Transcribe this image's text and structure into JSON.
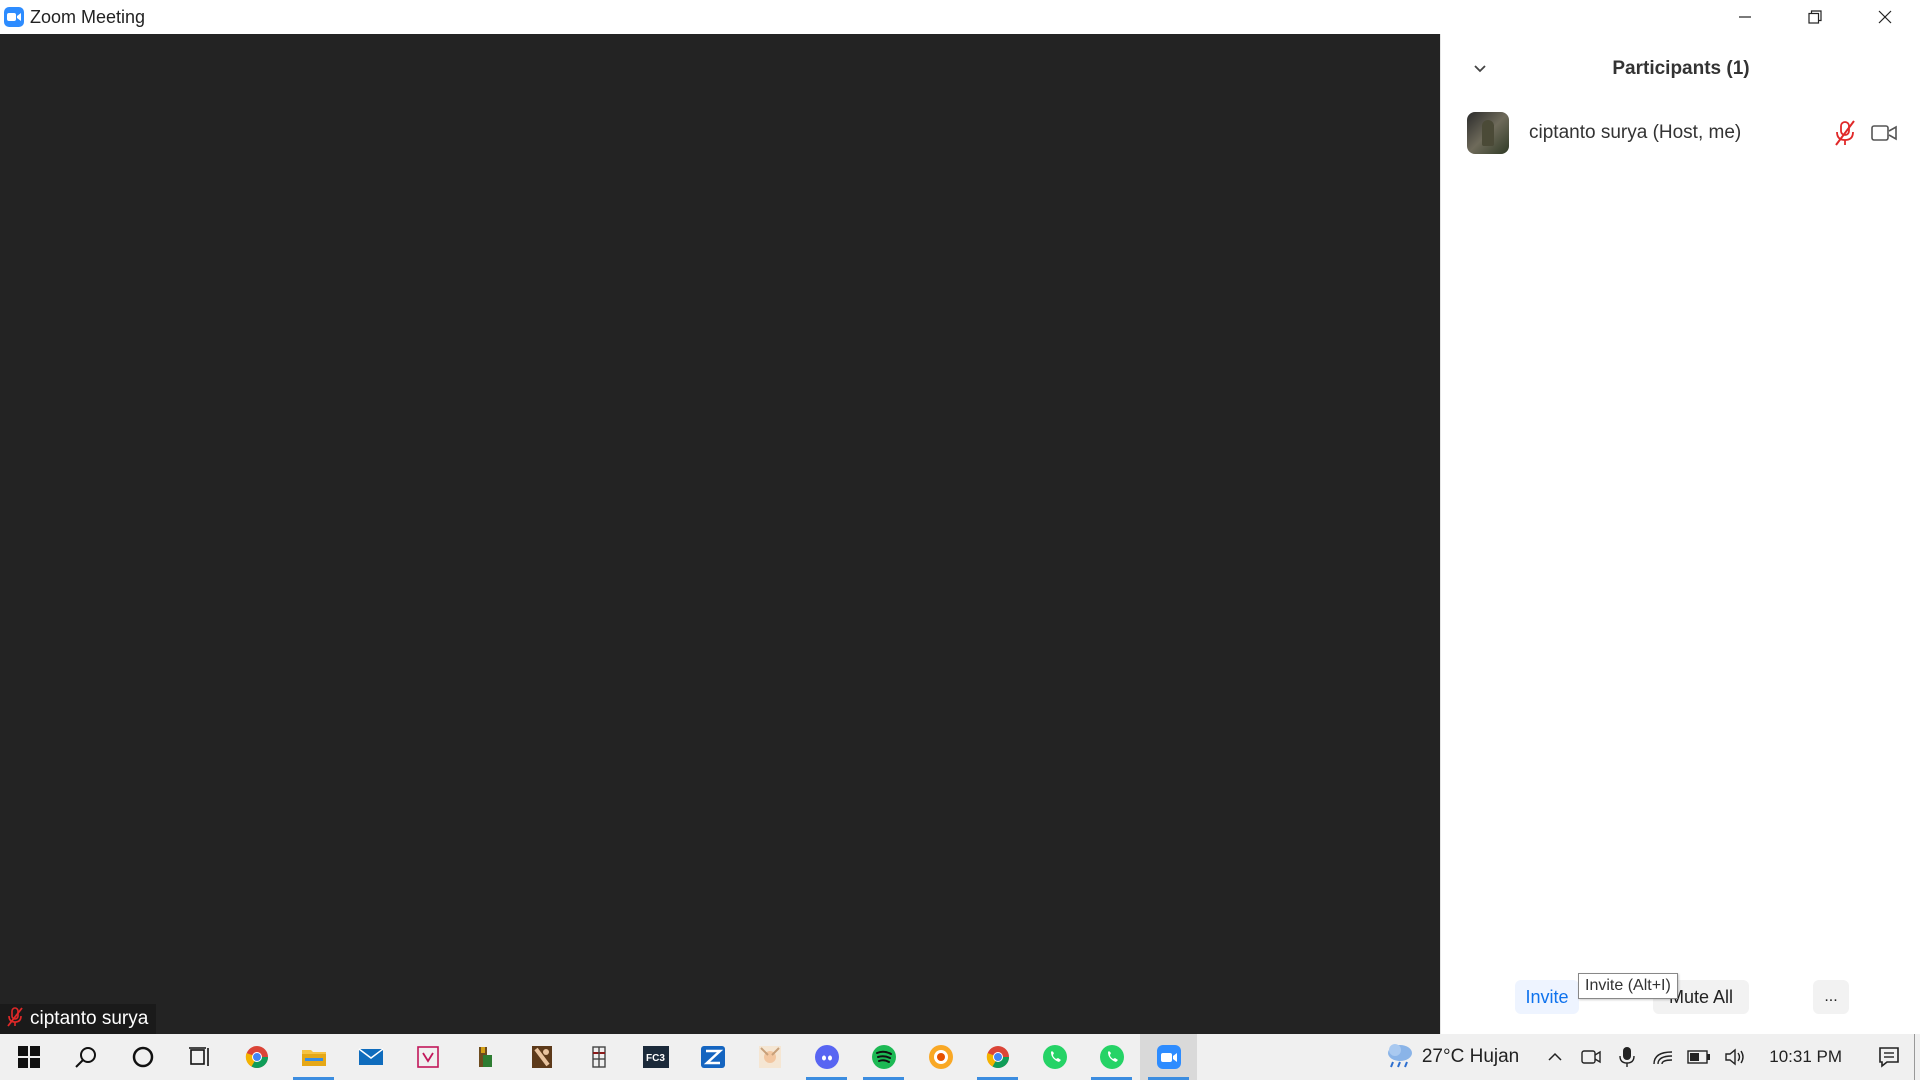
{
  "window": {
    "title": "Zoom Meeting",
    "controls": [
      "minimize",
      "restore",
      "close"
    ]
  },
  "video": {
    "name_tag": "ciptanto surya"
  },
  "participants_panel": {
    "title": "Participants (1)",
    "participants": [
      {
        "name": "ciptanto surya (Host, me)",
        "muted": true,
        "video": false
      }
    ],
    "footer": {
      "invite_label": "Invite",
      "mute_all_label": "Mute All",
      "more_label": "...",
      "tooltip": "Invite (Alt+I)"
    }
  },
  "taskbar": {
    "apps": [
      {
        "name": "chrome",
        "active": false
      },
      {
        "name": "file-explorer",
        "active": true
      },
      {
        "name": "mail",
        "active": false
      },
      {
        "name": "vegas",
        "active": false
      },
      {
        "name": "minecraft",
        "active": false
      },
      {
        "name": "game-1",
        "active": false
      },
      {
        "name": "game-2",
        "active": false
      },
      {
        "name": "fc3",
        "active": false
      },
      {
        "name": "zfile",
        "active": false
      },
      {
        "name": "anime-app",
        "active": false
      },
      {
        "name": "discord",
        "active": true
      },
      {
        "name": "spotify",
        "active": true
      },
      {
        "name": "media-player",
        "active": false
      },
      {
        "name": "chrome-2",
        "active": true
      },
      {
        "name": "whatsapp",
        "active": false
      },
      {
        "name": "whatsapp-2",
        "active": true
      },
      {
        "name": "zoom",
        "active": true
      }
    ],
    "weather": "27°C  Hujan",
    "clock": "10:31 PM"
  },
  "colors": {
    "video_bg": "#232323",
    "zoom_blue": "#2D8CFF",
    "muted_red": "#e02828"
  }
}
